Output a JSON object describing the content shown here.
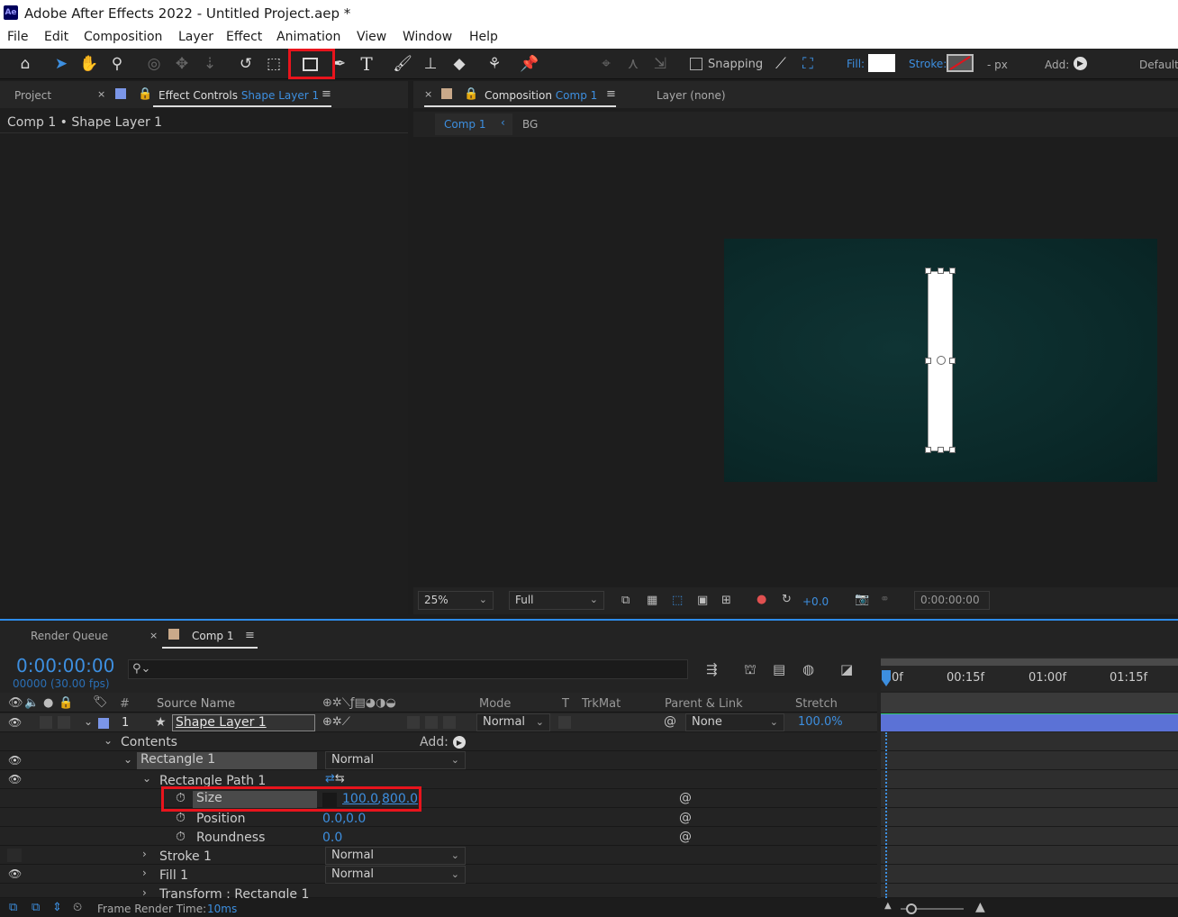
{
  "window": {
    "app_badge": "Ae",
    "title": "Adobe After Effects 2022 - Untitled Project.aep *"
  },
  "menu": [
    "File",
    "Edit",
    "Composition",
    "Layer",
    "Effect",
    "Animation",
    "View",
    "Window",
    "Help"
  ],
  "toolbar": {
    "snapping_label": "Snapping",
    "fill_label": "Fill:",
    "stroke_label": "Stroke:",
    "stroke_px": "- px",
    "add_label": "Add:",
    "workspace_label": "Default",
    "tools": [
      "home-icon",
      "selection-tool-icon",
      "hand-tool-icon",
      "zoom-tool-icon",
      "orbit-camera-icon",
      "pan-camera-icon",
      "dolly-camera-icon",
      "rotation-tool-icon",
      "pan-behind-icon",
      "rectangle-tool-icon",
      "pen-tool-icon",
      "type-tool-icon",
      "brush-tool-icon",
      "clone-stamp-icon",
      "eraser-tool-icon",
      "roto-brush-icon",
      "puppet-pin-icon"
    ],
    "colors": {
      "accent": "#2d8ceb",
      "highlight": "#e8141c"
    }
  },
  "left_panel": {
    "tab_project": "Project",
    "tab_effect_controls": "Effect Controls",
    "effect_controls_layer": "Shape Layer 1",
    "breadcrumb": "Comp 1 • Shape Layer 1"
  },
  "comp_panel": {
    "tab_composition": "Composition",
    "comp_name": "Comp 1",
    "layer_tab": "Layer (none)",
    "flow_items": [
      "Comp 1",
      "BG"
    ],
    "zoom": "25%",
    "resolution": "Full",
    "exposure": "+0.0",
    "timecode": "0:00:00:00",
    "canvas_color": "#0b2c2c"
  },
  "timeline": {
    "tab_render_queue": "Render Queue",
    "tab_comp": "Comp 1",
    "current_time": "0:00:00:00",
    "frame_info": "00000 (30.00 fps)",
    "search_placeholder": "",
    "columns": {
      "hash": "#",
      "source_name": "Source Name",
      "mode": "Mode",
      "t": "T",
      "trkmat": "TrkMat",
      "parent": "Parent & Link",
      "stretch": "Stretch"
    },
    "ruler": [
      "0f",
      "00:15f",
      "01:00f",
      "01:15f"
    ],
    "layer": {
      "index": "1",
      "name": "Shape Layer 1",
      "mode": "Normal",
      "parent": "None",
      "stretch": "100.0%"
    },
    "contents_label": "Contents",
    "add_label": "Add:",
    "rectangle": {
      "name": "Rectangle 1",
      "mode": "Normal"
    },
    "rect_path": {
      "name": "Rectangle Path 1"
    },
    "size": {
      "label": "Size",
      "value_w": "100.0",
      "value_h": "800.0"
    },
    "position": {
      "label": "Position",
      "value_x": "0.0",
      "value_y": "0.0"
    },
    "roundness": {
      "label": "Roundness",
      "value": "0.0"
    },
    "stroke": {
      "name": "Stroke 1",
      "mode": "Normal"
    },
    "fill": {
      "name": "Fill 1",
      "mode": "Normal"
    },
    "transform": {
      "name": "Transform : Rectangle 1"
    },
    "footer": {
      "label": "Frame Render Time:",
      "value": "10ms"
    }
  }
}
